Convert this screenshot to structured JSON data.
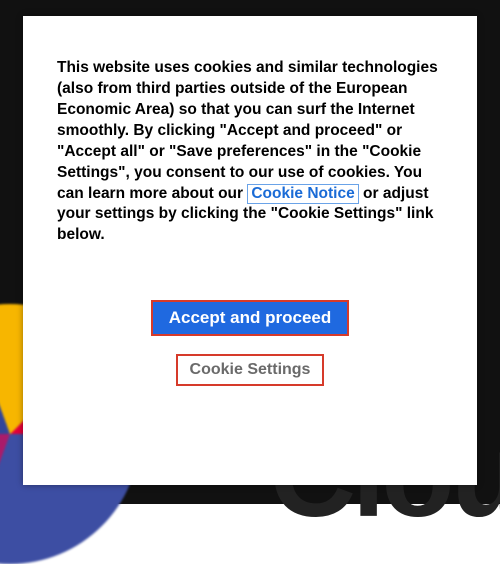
{
  "modal": {
    "text_before_link": "This website uses cookies and similar technologies (also from third parties outside of the European Economic Area) so that you can surf the Internet smoothly. By clicking \"Accept and proceed\" or \"Accept all\" or \"Save preferences\" in the \"Cookie Settings\", you consent to our use of cookies. You can learn more about our ",
    "link_text": "Cookie Notice",
    "text_after_link": " or adjust your settings by clicking the \"Cookie Settings\" link below.",
    "accept_label": "Accept and proceed",
    "settings_label": "Cookie Settings"
  }
}
